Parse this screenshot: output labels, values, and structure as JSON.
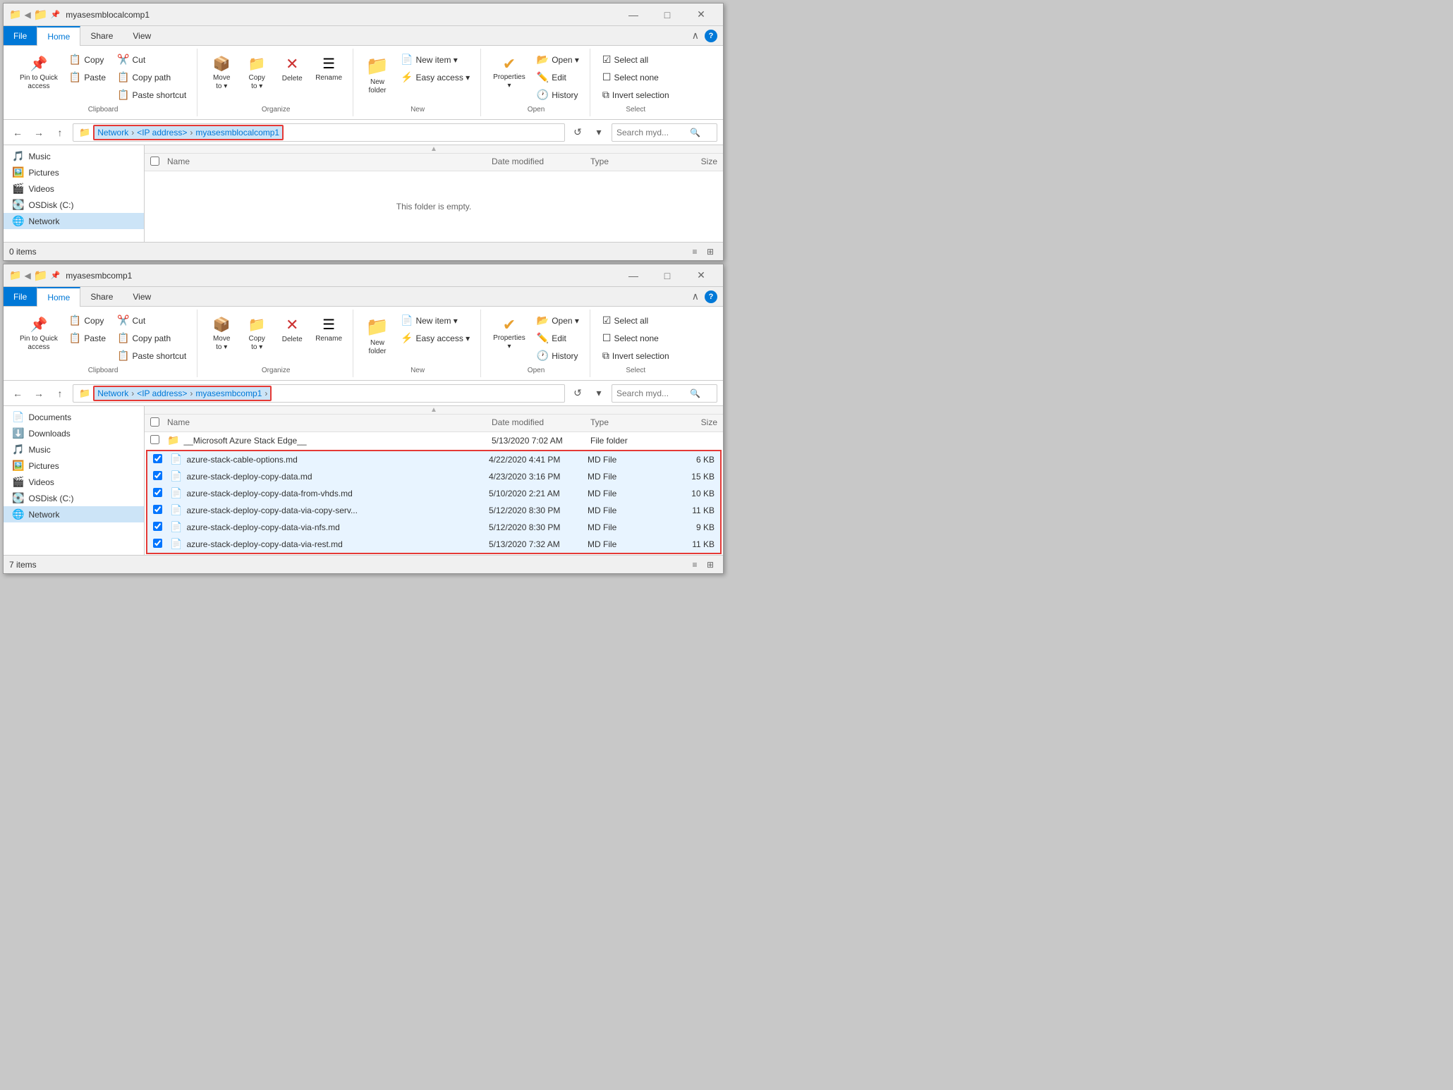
{
  "windows": [
    {
      "id": "upper",
      "title": "myasesmblocalcomp1",
      "ribbon": {
        "tabs": [
          "File",
          "Home",
          "Share",
          "View"
        ],
        "activeTab": "Home",
        "groups": {
          "clipboard": {
            "label": "Clipboard",
            "items": [
              {
                "id": "pin-quick-access",
                "label": "Pin to Quick\naccess",
                "icon": "📌",
                "type": "large"
              },
              {
                "id": "copy",
                "label": "Copy",
                "icon": "📋",
                "type": "large"
              },
              {
                "id": "paste",
                "label": "Paste",
                "icon": "📋",
                "type": "large"
              },
              {
                "id": "cut",
                "label": "Cut",
                "icon": "✂️",
                "type": "small"
              },
              {
                "id": "copy-path",
                "label": "Copy path",
                "icon": "📋",
                "type": "small"
              },
              {
                "id": "paste-shortcut",
                "label": "Paste shortcut",
                "icon": "📋",
                "type": "small"
              }
            ]
          },
          "organize": {
            "label": "Organize",
            "items": [
              {
                "id": "move-to",
                "label": "Move\nto",
                "icon": "📦",
                "type": "large-dropdown"
              },
              {
                "id": "copy-to",
                "label": "Copy\nto",
                "icon": "📁",
                "type": "large-dropdown"
              },
              {
                "id": "delete",
                "label": "Delete",
                "icon": "✕",
                "type": "large"
              },
              {
                "id": "rename",
                "label": "Rename",
                "icon": "☰",
                "type": "large"
              }
            ]
          },
          "new": {
            "label": "New",
            "items": [
              {
                "id": "new-folder",
                "label": "New\nfolder",
                "icon": "📁",
                "type": "large"
              },
              {
                "id": "new-item",
                "label": "New item",
                "icon": "📄",
                "type": "small-dropdown"
              },
              {
                "id": "easy-access",
                "label": "Easy access",
                "icon": "⚡",
                "type": "small-dropdown"
              }
            ]
          },
          "open": {
            "label": "Open",
            "items": [
              {
                "id": "properties",
                "label": "Properties",
                "icon": "✔",
                "type": "large"
              },
              {
                "id": "open",
                "label": "Open",
                "icon": "📂",
                "type": "small-dropdown"
              },
              {
                "id": "edit",
                "label": "Edit",
                "icon": "✏️",
                "type": "small"
              },
              {
                "id": "history",
                "label": "History",
                "icon": "🕐",
                "type": "small"
              }
            ]
          },
          "select": {
            "label": "Select",
            "items": [
              {
                "id": "select-all",
                "label": "Select all",
                "icon": "☑",
                "type": "small"
              },
              {
                "id": "select-none",
                "label": "Select none",
                "icon": "☐",
                "type": "small"
              },
              {
                "id": "invert-selection",
                "label": "Invert selection",
                "icon": "⧉",
                "type": "small"
              }
            ]
          }
        }
      },
      "addressbar": {
        "path": "Network > <IP address> > myasesmblocalcomp1",
        "segments": [
          "Network",
          "<IP address>",
          "myasesmblocalcomp1"
        ],
        "searchPlaceholder": "Search myd...",
        "highlighted": true
      },
      "sidebar": {
        "items": [
          {
            "id": "music",
            "label": "Music",
            "icon": "🎵"
          },
          {
            "id": "pictures",
            "label": "Pictures",
            "icon": "🖼️"
          },
          {
            "id": "videos",
            "label": "Videos",
            "icon": "🎬"
          },
          {
            "id": "osdisk",
            "label": "OSDisk (C:)",
            "icon": "💽"
          },
          {
            "id": "network",
            "label": "Network",
            "icon": "🌐",
            "selected": true
          }
        ]
      },
      "content": {
        "columns": [
          "Name",
          "Date modified",
          "Type",
          "Size"
        ],
        "files": [],
        "emptyMessage": "This folder is empty."
      },
      "statusbar": {
        "text": "0 items"
      }
    },
    {
      "id": "lower",
      "title": "myasesmbcomp1",
      "ribbon": {
        "tabs": [
          "File",
          "Home",
          "Share",
          "View"
        ],
        "activeTab": "Home"
      },
      "addressbar": {
        "path": "Network > <IP address> > myasesmbcomp1 >",
        "segments": [
          "Network",
          "<IP address>",
          "myasesmbcomp1"
        ],
        "searchPlaceholder": "Search myd...",
        "highlighted": true
      },
      "sidebar": {
        "items": [
          {
            "id": "documents",
            "label": "Documents",
            "icon": "📄"
          },
          {
            "id": "downloads",
            "label": "Downloads",
            "icon": "⬇️"
          },
          {
            "id": "music",
            "label": "Music",
            "icon": "🎵"
          },
          {
            "id": "pictures",
            "label": "Pictures",
            "icon": "🖼️"
          },
          {
            "id": "videos",
            "label": "Videos",
            "icon": "🎬"
          },
          {
            "id": "osdisk",
            "label": "OSDisk (C:)",
            "icon": "💽"
          },
          {
            "id": "network",
            "label": "Network",
            "icon": "🌐",
            "selected": true
          }
        ]
      },
      "content": {
        "columns": [
          "Name",
          "Date modified",
          "Type",
          "Size"
        ],
        "files": [
          {
            "name": "__Microsoft Azure Stack Edge__",
            "date": "5/13/2020 7:02 AM",
            "type": "File folder",
            "size": "",
            "icon": "📁",
            "selected": false
          },
          {
            "name": "azure-stack-cable-options.md",
            "date": "4/22/2020 4:41 PM",
            "type": "MD File",
            "size": "6 KB",
            "icon": "📄",
            "selected": true
          },
          {
            "name": "azure-stack-deploy-copy-data.md",
            "date": "4/23/2020 3:16 PM",
            "type": "MD File",
            "size": "15 KB",
            "icon": "📄",
            "selected": true
          },
          {
            "name": "azure-stack-deploy-copy-data-from-vhds.md",
            "date": "5/10/2020 2:21 AM",
            "type": "MD File",
            "size": "10 KB",
            "icon": "📄",
            "selected": true
          },
          {
            "name": "azure-stack-deploy-copy-data-via-copy-serv...",
            "date": "5/12/2020 8:30 PM",
            "type": "MD File",
            "size": "11 KB",
            "icon": "📄",
            "selected": true
          },
          {
            "name": "azure-stack-deploy-copy-data-via-nfs.md",
            "date": "5/12/2020 8:30 PM",
            "type": "MD File",
            "size": "9 KB",
            "icon": "📄",
            "selected": true
          },
          {
            "name": "azure-stack-deploy-copy-data-via-rest.md",
            "date": "5/13/2020 7:32 AM",
            "type": "MD File",
            "size": "11 KB",
            "icon": "📄",
            "selected": true
          }
        ],
        "emptyMessage": ""
      },
      "statusbar": {
        "text": "7 items"
      }
    }
  ],
  "labels": {
    "minimize": "—",
    "maximize": "□",
    "close": "✕",
    "back": "←",
    "forward": "→",
    "up": "↑",
    "chevron_down": "▾",
    "refresh": "↺",
    "search_icon": "🔍"
  }
}
